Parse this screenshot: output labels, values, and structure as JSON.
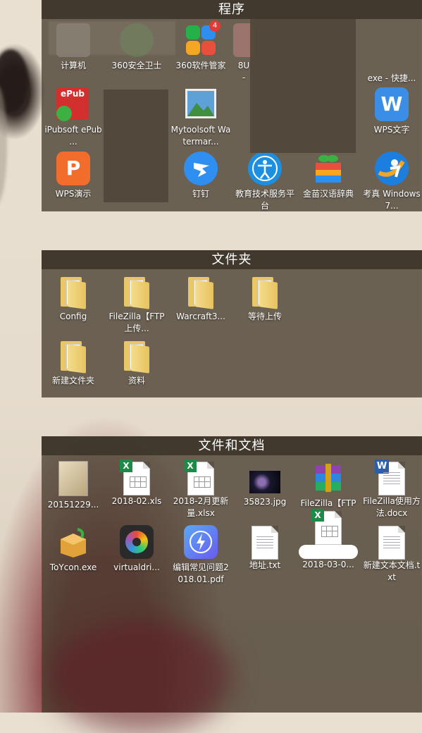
{
  "sections": {
    "programs": {
      "title": "程序",
      "items": [
        {
          "label": "计算机",
          "icon": "computer-icon"
        },
        {
          "label": "360安全卫士",
          "icon": "360-security-icon"
        },
        {
          "label": "360软件管家",
          "icon": "360-software-manager-icon",
          "badge": "4"
        },
        {
          "label": "8U\n-",
          "icon": "app-icon"
        },
        {
          "label": "exe - 快捷...",
          "icon": "shortcut-icon"
        },
        {
          "label": "iPubsoft ePub ...",
          "icon": "epub-icon",
          "icon_text": "ePub"
        },
        {
          "label": "Mytoolsoft Watermar...",
          "icon": "landscape-icon"
        },
        {
          "label": "WPS文字",
          "icon": "wps-writer-icon",
          "icon_text": "W"
        },
        {
          "label": "WPS演示",
          "icon": "wps-presentation-icon",
          "icon_text": "P"
        },
        {
          "label": "钉钉",
          "icon": "dingtalk-icon"
        },
        {
          "label": "教育技术服务平台",
          "icon": "education-platform-icon"
        },
        {
          "label": "金苗汉语辞典",
          "icon": "dictionary-icon"
        },
        {
          "label": "考真 Windows7...",
          "icon": "kaozhen-icon"
        }
      ]
    },
    "folders": {
      "title": "文件夹",
      "items": [
        {
          "label": "Config",
          "icon": "folder-icon"
        },
        {
          "label": "FileZilla【FTP上传...",
          "icon": "folder-icon"
        },
        {
          "label": "Warcraft3...",
          "icon": "folder-icon"
        },
        {
          "label": "等待上传",
          "icon": "folder-icon"
        },
        {
          "label": "新建文件夹",
          "icon": "folder-icon"
        },
        {
          "label": "资料",
          "icon": "folder-icon"
        }
      ]
    },
    "files": {
      "title": "文件和文档",
      "items": [
        {
          "label": "20151229...",
          "icon": "image-file-icon"
        },
        {
          "label": "2018-02.xls",
          "icon": "excel-file-icon"
        },
        {
          "label": "2018-2月更新量.xlsx",
          "icon": "excel-file-icon"
        },
        {
          "label": "35823.jpg",
          "icon": "jpg-file-icon"
        },
        {
          "label": "FileZilla【FTP上传...",
          "icon": "rar-file-icon"
        },
        {
          "label": "FileZilla使用方法.docx",
          "icon": "word-file-icon"
        },
        {
          "label": "ToYcon.exe",
          "icon": "toycon-exe-icon"
        },
        {
          "label": "virtualdri...",
          "icon": "virtualdrive-icon"
        },
        {
          "label": "编辑常见问题2018.01.pdf",
          "icon": "pdf-file-icon"
        },
        {
          "label": "地址.txt",
          "icon": "text-file-icon"
        },
        {
          "label": "2018-03-0...",
          "icon": "excel-file-icon"
        },
        {
          "label": "新建文本文档.txt",
          "icon": "text-file-icon"
        }
      ]
    }
  },
  "badges": {
    "xls": "X",
    "word": "W"
  },
  "colors": {
    "fence_bg": "#4a3f31",
    "title_bar": "#3a3228",
    "wps_writer": "#3a8ee6",
    "wps_presentation": "#f26d2c",
    "dingtalk": "#2f8ff0",
    "excel": "#1e8a48",
    "word": "#2b5faa"
  }
}
